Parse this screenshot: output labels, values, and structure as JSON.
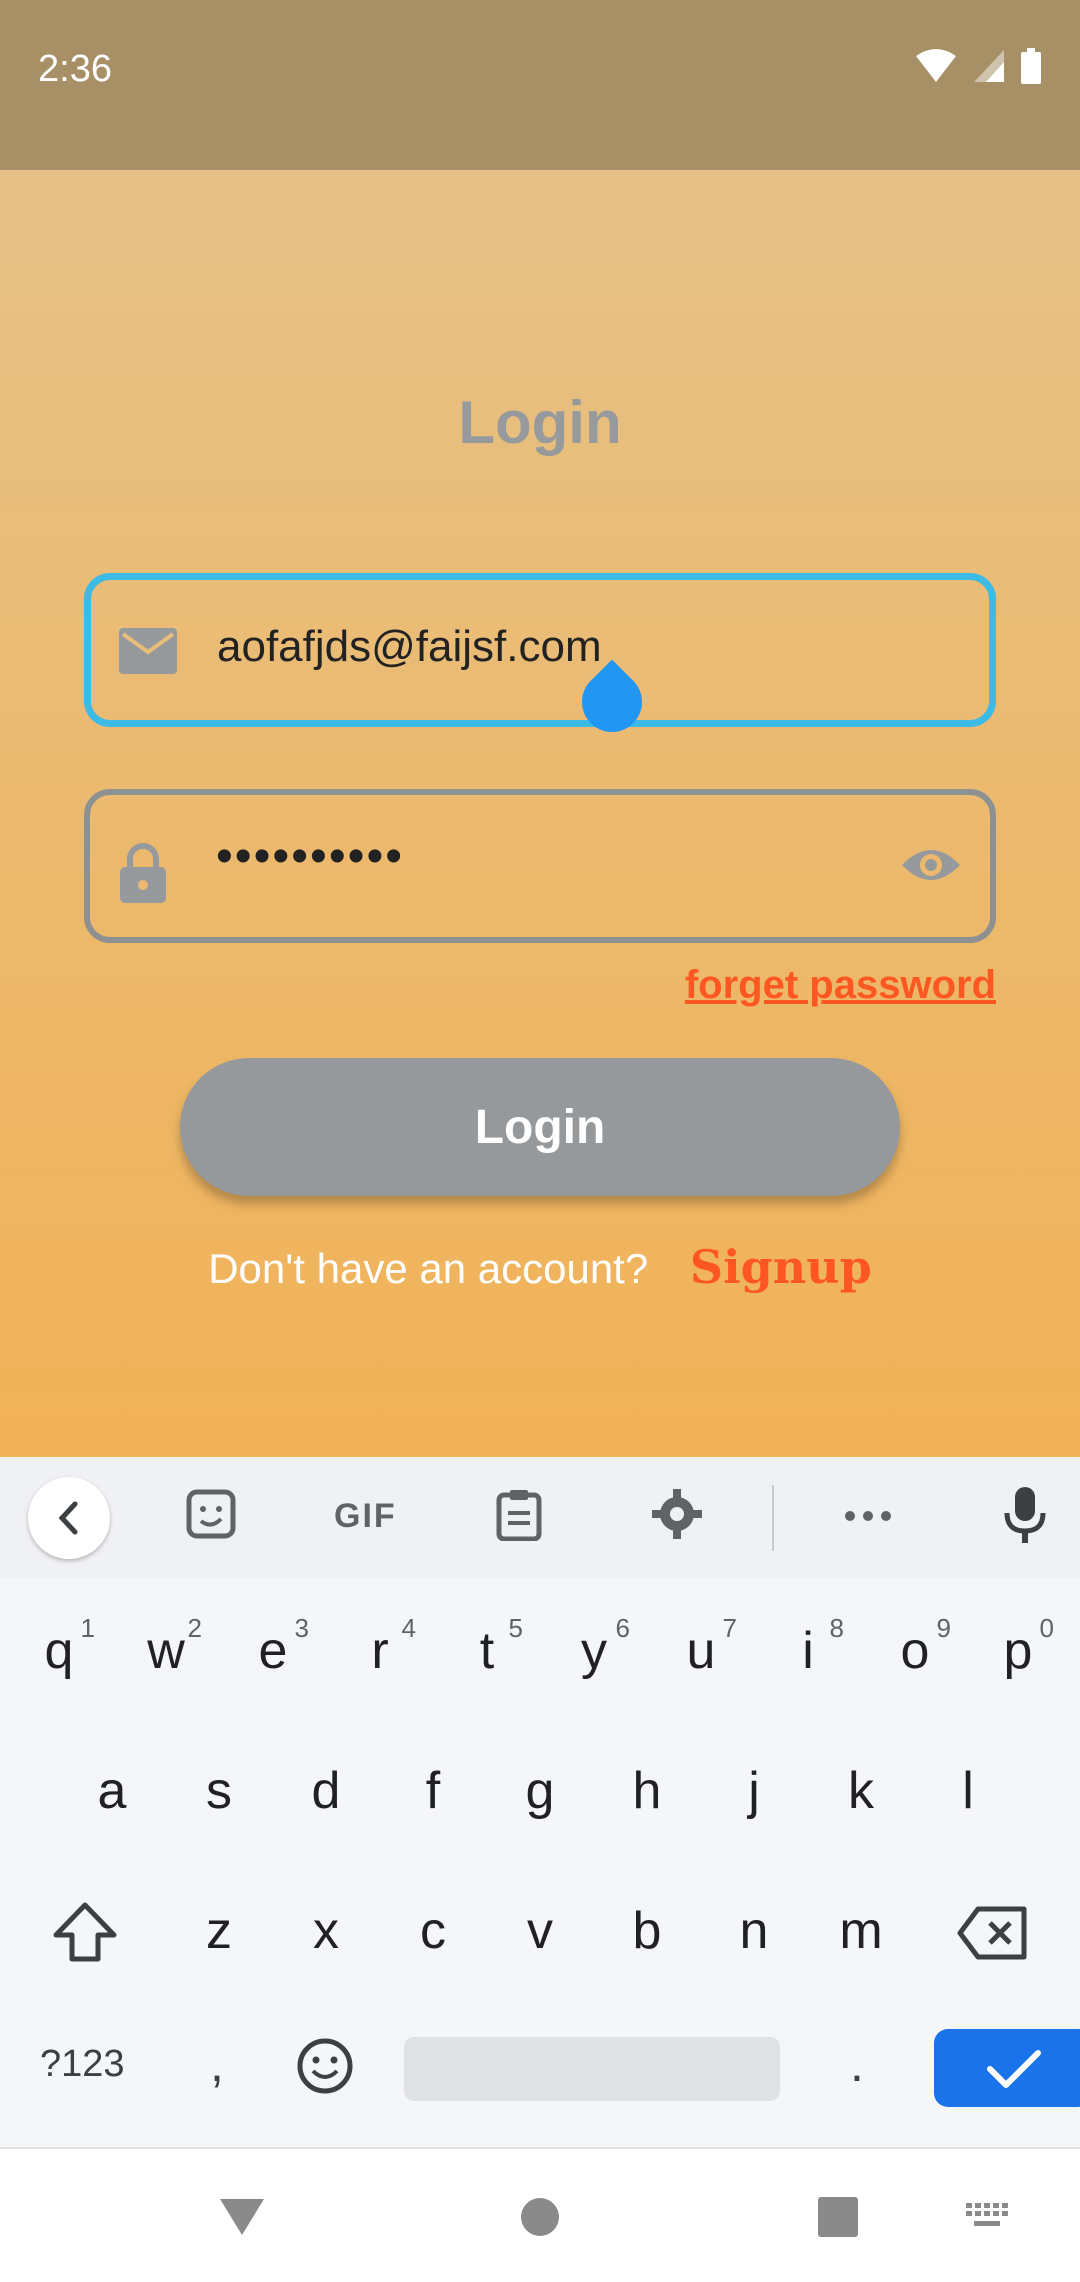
{
  "status_bar": {
    "time": "2:36"
  },
  "login": {
    "title": "Login",
    "email": {
      "value": "aofafjds@faijsf.com",
      "icon": "mail-icon"
    },
    "password": {
      "value": "••••••••••",
      "icon": "lock-icon",
      "toggle_icon": "eye-icon"
    },
    "forget_password": "forget password",
    "button_label": "Login",
    "signup_prompt": "Don't have an account?",
    "signup_link": "Signup"
  },
  "keyboard": {
    "toolbar": {
      "gif_label": "GIF",
      "icons": [
        "back-icon",
        "sticker-icon",
        "gif-icon",
        "clipboard-icon",
        "settings-icon",
        "more-icon",
        "mic-icon"
      ]
    },
    "rows": [
      [
        {
          "k": "q",
          "h": "1"
        },
        {
          "k": "w",
          "h": "2"
        },
        {
          "k": "e",
          "h": "3"
        },
        {
          "k": "r",
          "h": "4"
        },
        {
          "k": "t",
          "h": "5"
        },
        {
          "k": "y",
          "h": "6"
        },
        {
          "k": "u",
          "h": "7"
        },
        {
          "k": "i",
          "h": "8"
        },
        {
          "k": "o",
          "h": "9"
        },
        {
          "k": "p",
          "h": "0"
        }
      ],
      [
        {
          "k": "a"
        },
        {
          "k": "s"
        },
        {
          "k": "d"
        },
        {
          "k": "f"
        },
        {
          "k": "g"
        },
        {
          "k": "h"
        },
        {
          "k": "j"
        },
        {
          "k": "k"
        },
        {
          "k": "l"
        }
      ],
      [
        {
          "k": "z"
        },
        {
          "k": "x"
        },
        {
          "k": "c"
        },
        {
          "k": "v"
        },
        {
          "k": "b"
        },
        {
          "k": "n"
        },
        {
          "k": "m"
        }
      ]
    ],
    "symbols_label": "?123",
    "comma": ",",
    "period": "."
  },
  "colors": {
    "accent_orange": "#ff5722",
    "focus_blue": "#3cbbe6",
    "enter_blue": "#1a73e8"
  }
}
